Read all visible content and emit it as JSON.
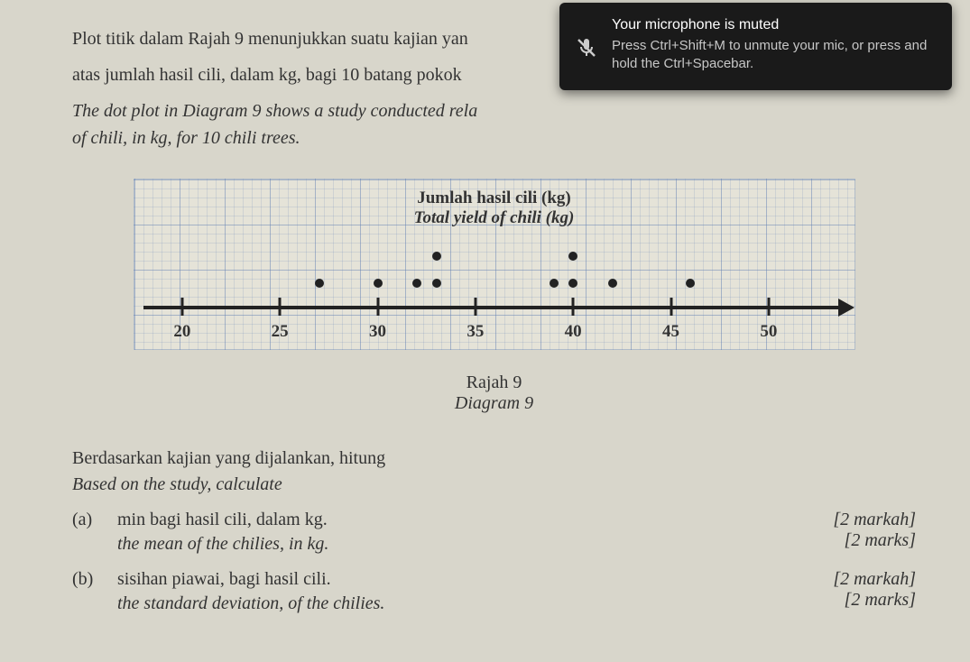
{
  "intro": {
    "line1": "Plot titik dalam Rajah 9 menunjukkan suatu kajian yan",
    "line2": "atas jumlah hasil cili, dalam kg, bagi 10 batang pokok",
    "italic1": "The dot plot in Diagram 9 shows a study conducted rela",
    "italic2": "of chili, in kg, for 10 chili trees."
  },
  "chart_data": {
    "type": "dot-plot",
    "title_ms": "Jumlah hasil cili (kg)",
    "title_en": "Total yield of chili (kg)",
    "xlabel": "",
    "x_ticks": [
      20,
      25,
      30,
      35,
      40,
      45,
      50
    ],
    "xlim": [
      18,
      54
    ],
    "values": [
      27,
      30,
      32,
      33,
      33,
      39,
      40,
      40,
      42,
      46
    ],
    "counts": [
      {
        "x": 27,
        "n": 1
      },
      {
        "x": 30,
        "n": 1
      },
      {
        "x": 32,
        "n": 1
      },
      {
        "x": 33,
        "n": 2
      },
      {
        "x": 39,
        "n": 1
      },
      {
        "x": 40,
        "n": 2
      },
      {
        "x": 42,
        "n": 1
      },
      {
        "x": 46,
        "n": 1
      }
    ]
  },
  "caption": {
    "ms": "Rajah 9",
    "en": "Diagram 9"
  },
  "calc": {
    "ms": "Berdasarkan kajian yang dijalankan, hitung",
    "en": "Based on the study, calculate"
  },
  "questions": {
    "a": {
      "label": "(a)",
      "ms": "min bagi hasil cili, dalam kg.",
      "en": "the mean of the chilies, in kg.",
      "marks_ms": "[2 markah]",
      "marks_en": "[2 marks]"
    },
    "b": {
      "label": "(b)",
      "ms": "sisihan piawai, bagi hasil cili.",
      "en": "the standard deviation, of the chilies.",
      "marks_ms": "[2 markah]",
      "marks_en": "[2 marks]"
    }
  },
  "toast": {
    "title": "Your microphone is muted",
    "body": "Press Ctrl+Shift+M to unmute your mic, or press and hold the Ctrl+Spacebar."
  }
}
